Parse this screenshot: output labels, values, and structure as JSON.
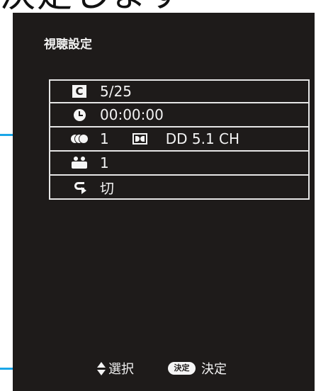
{
  "header": {
    "caption": "決定します"
  },
  "screen": {
    "title": "視聴設定"
  },
  "info_rows": [
    {
      "icon": "chapter-icon",
      "icon_text": "C",
      "value": "5/25"
    },
    {
      "icon": "clock-icon",
      "value": "00:00:00"
    },
    {
      "icon": "audio-icon",
      "value": "1",
      "secondary_icon": "dolby-icon",
      "format": "DD 5.1 CH"
    },
    {
      "icon": "angle-icon",
      "value": "1"
    },
    {
      "icon": "repeat-icon",
      "value": "切"
    }
  ],
  "footer": {
    "select_label": "選択",
    "decide_button": "決定",
    "decide_label": "決定"
  },
  "colors": {
    "screen_background": "#1e1b1a",
    "accent": "#1aa6e8",
    "text": "#f3f3f3"
  }
}
